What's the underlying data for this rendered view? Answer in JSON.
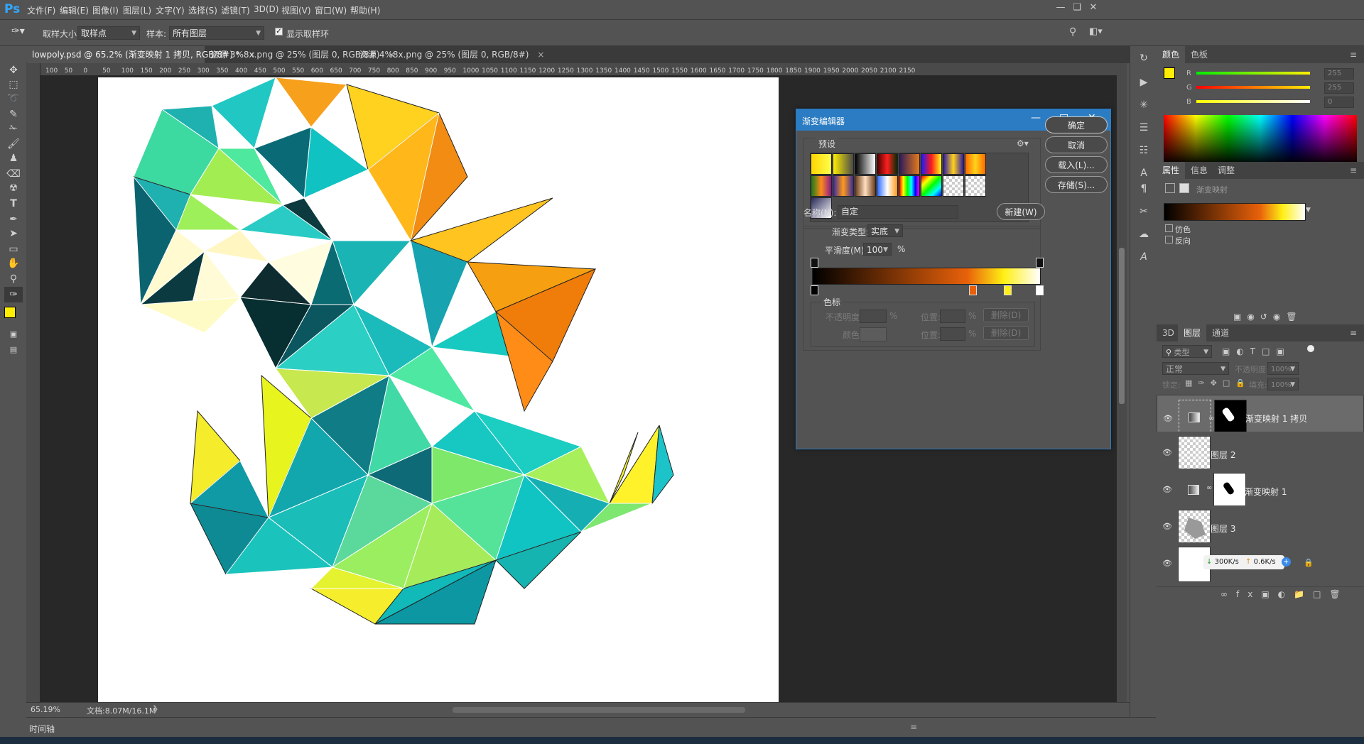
{
  "app": {
    "logo": "Ps"
  },
  "menu": [
    "文件(F)",
    "编辑(E)",
    "图像(I)",
    "图层(L)",
    "文字(Y)",
    "选择(S)",
    "滤镜(T)",
    "3D(D)",
    "视图(V)",
    "窗口(W)",
    "帮助(H)"
  ],
  "options": {
    "sample_size_label": "取样大小:",
    "sample_size_value": "取样点",
    "sample_label": "样本:",
    "sample_value": "所有图层",
    "show_ring_label": "显示取样环"
  },
  "tabs": [
    {
      "label": "lowpoly.psd @ 65.2% (渐变映射 1 拷贝, RGB/8#) *"
    },
    {
      "label": "资源 3%8x.png @ 25% (图层 0, RGB/8#)"
    },
    {
      "label": "资源 4%8x.png @ 25% (图层 0, RGB/8#)"
    }
  ],
  "ruler_ticks": [
    "100",
    "50",
    "0",
    "50",
    "100",
    "150",
    "200",
    "250",
    "300",
    "350",
    "400",
    "450",
    "500",
    "550",
    "600",
    "650",
    "700",
    "750",
    "800",
    "850",
    "900",
    "950",
    "1000",
    "1050",
    "1100",
    "1150",
    "1200",
    "1250",
    "1300",
    "1350",
    "1400",
    "1450",
    "1500",
    "1550",
    "1600",
    "1650",
    "1700",
    "1750",
    "1800",
    "1850",
    "1900",
    "1950",
    "2000",
    "2050",
    "2100",
    "2150"
  ],
  "status": {
    "zoom": "65.19%",
    "doc": "文档:8.07M/16.1M"
  },
  "timeline_label": "时间轴",
  "dialog": {
    "title": "渐变编辑器",
    "preset_label": "预设",
    "buttons": {
      "ok": "确定",
      "cancel": "取消",
      "load": "载入(L)...",
      "save": "存储(S)...",
      "new": "新建(W)"
    },
    "name_label": "名称(N):",
    "name_value": "自定",
    "type_label": "渐变类型:",
    "type_value": "实底",
    "smooth_label": "平滑度(M):",
    "smooth_value": "100",
    "smooth_unit": "%",
    "stops_label": "色标",
    "opacity_label": "不透明度:",
    "percent": "%",
    "position_label": "位置:",
    "delete_label": "删除(D)",
    "color_label": "颜色:",
    "gradient_colors": [
      "#000000",
      "#e8610a",
      "#ffef14",
      "#ffffff"
    ]
  },
  "color_panel": {
    "tabs": [
      "颜色",
      "色板"
    ],
    "r_label": "R",
    "g_label": "G",
    "b_label": "B",
    "r_value": "255",
    "g_value": "255",
    "b_value": "0",
    "foreground": "#ffee00"
  },
  "properties": {
    "tabs": [
      "属性",
      "信息",
      "调整"
    ],
    "title": "渐变映射",
    "dither_label": "仿色",
    "reverse_label": "反向"
  },
  "layers_panel": {
    "tabs": [
      "3D",
      "图层",
      "通道"
    ],
    "filter_label": "类型",
    "blend_mode": "正常",
    "opacity_label": "不透明度:",
    "opacity_value": "100%",
    "lock_label": "锁定:",
    "fill_label": "填充:",
    "fill_value": "100%",
    "layers": [
      {
        "name": "渐变映射 1 拷贝"
      },
      {
        "name": "图层 2"
      },
      {
        "name": "渐变映射 1"
      },
      {
        "name": "图层 3"
      },
      {
        "name": ""
      }
    ],
    "net_down": "300K/s",
    "net_up": "0.6K/s"
  }
}
